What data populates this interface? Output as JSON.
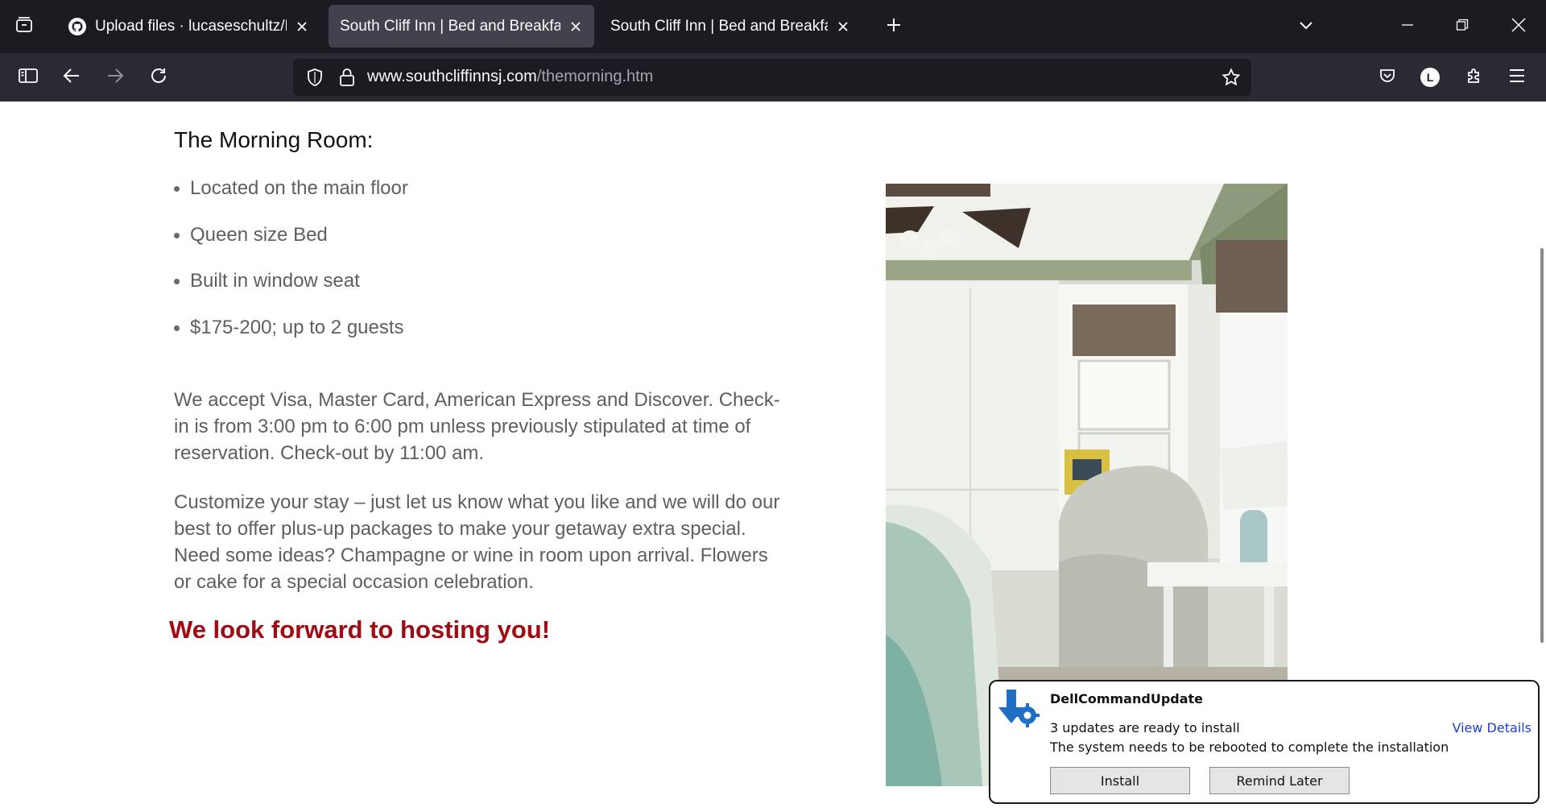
{
  "browser": {
    "tabs": [
      {
        "title": "Upload files · lucaseschultz/HTT",
        "active": false,
        "favicon": "github-icon"
      },
      {
        "title": "South Cliff Inn | Bed and Breakfast |",
        "active": true,
        "favicon": "none"
      },
      {
        "title": "South Cliff Inn | Bed and Breakfast |",
        "active": false,
        "favicon": "none"
      }
    ],
    "url_domain": "www.southcliffinnsj.com",
    "url_path": "/themorning.htm",
    "profile_initial": "L"
  },
  "page": {
    "title": "The Morning Room:",
    "features": [
      "Located on the main floor",
      "Queen size Bed",
      "Built in window seat",
      "$175-200; up to 2 guests"
    ],
    "payment_text": "We accept Visa, Master Card, American Express and Discover. Check-in is from 3:00 pm to 6:00 pm unless previously stipulated at time of reservation. Check-out by 11:00 am.",
    "customize_text": "Customize your stay – just let us know what you like and we will do our best to offer plus-up packages to make your getaway extra special. Need some ideas? Champagne or wine in room upon arrival. Flowers or cake for a special occasion celebration.",
    "closing": "We look forward to hosting you!"
  },
  "notification": {
    "app_name": "DellCommandUpdate",
    "line1": "3 updates are ready to install",
    "line2": "The system needs to be rebooted to complete the installation",
    "details_link": "View Details",
    "install_label": "Install",
    "remind_label": "Remind Later"
  }
}
